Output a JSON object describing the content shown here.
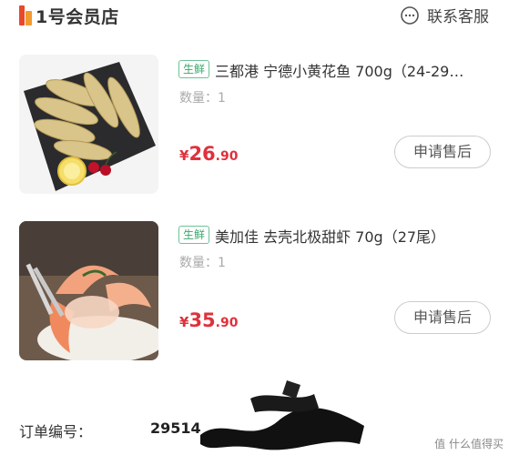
{
  "header": {
    "logo_text": "1号会员店",
    "service_label": "联系客服",
    "service_icon": "chat-icon"
  },
  "items": [
    {
      "tag": "生鲜",
      "title": "三都港 宁德小黄花鱼 700g（24-29…",
      "qty": "数量：1",
      "price_currency": "¥",
      "price_int": "26",
      "price_dec": ".90",
      "button": "申请售后"
    },
    {
      "tag": "生鲜",
      "title": "美加佳 去壳北极甜虾 70g（27尾）",
      "qty": "数量：1",
      "price_currency": "¥",
      "price_int": "35",
      "price_dec": ".90",
      "button": "申请售后"
    }
  ],
  "order": {
    "label": "订单编号：",
    "number": "29514"
  },
  "watermark": "值 什么值得买",
  "colors": {
    "price": "#e0313c",
    "tag": "#3aa56b",
    "logo_red": "#e8492a",
    "logo_orange": "#f29a2e"
  }
}
